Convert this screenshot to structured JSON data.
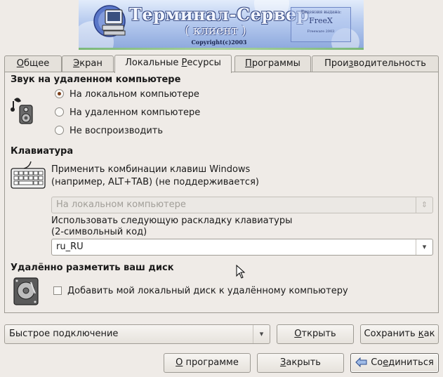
{
  "banner": {
    "title": "Терминал-Сервер",
    "subtitle": "( клиент )",
    "copyright": "Copyright(c)2003",
    "logo_line1": "Лицензия выдана:",
    "logo_line2": "FreeX",
    "logo_line3": "Freeware 2003"
  },
  "tabs": [
    {
      "label": "Общее",
      "u": "О",
      "rest": "бщее"
    },
    {
      "label": "Экран",
      "u": "Э",
      "rest": "кран"
    },
    {
      "label": "Локальные Ресурсы",
      "pre": "Локальные ",
      "u": "Р",
      "rest": "есурсы"
    },
    {
      "label": "Программы",
      "u": "П",
      "rest": "рограммы"
    },
    {
      "label": "Производительность",
      "pre": "Прои",
      "u": "з",
      "rest": "водительность"
    }
  ],
  "sound": {
    "title": "Звук на удаленном компьютере",
    "options": [
      "На локальном компьютере",
      "На удаленном компьютере",
      "Не воспроизводить"
    ],
    "selected": "На локальном компьютере"
  },
  "keyboard": {
    "title": "Клавиатура",
    "desc_line1": "Применить комбинации клавиш Windows",
    "desc_line2": "(например, ALT+TAB) (не поддерживается)",
    "apply_combo_value": "На локальном компьютере",
    "layout_label_line1": "Использовать следующую раскладку клавиатуры",
    "layout_label_line2": "(2-символьный код)",
    "layout_value": "ru_RU"
  },
  "disk": {
    "title": "Удалённо разметить ваш диск",
    "checkbox_label": "Добавить мой локальный диск к удалённому компьютеру",
    "checked": false
  },
  "footer": {
    "quick_connect_value": "Быстрое подключение",
    "open_label": "Открыть",
    "open_u": "О",
    "open_rest": "ткрыть",
    "save_as_pre": "Сохранить ",
    "save_as_u": "к",
    "save_as_rest": "ак",
    "about_u": "О",
    "about_rest": " программе",
    "close_u": "З",
    "close_rest": "акрыть",
    "connect_pre": "Со",
    "connect_u": "е",
    "connect_rest": "диниться"
  },
  "icons": {
    "banner": "computer-icon",
    "sound": "speaker-icon",
    "keyboard": "keyboard-icon",
    "disk": "hard-disk-icon",
    "connect": "connect-arrow-icon"
  },
  "colors": {
    "window_bg": "#efebe7",
    "banner_blue": "#8faade",
    "radio_dot": "#7a3d17"
  }
}
